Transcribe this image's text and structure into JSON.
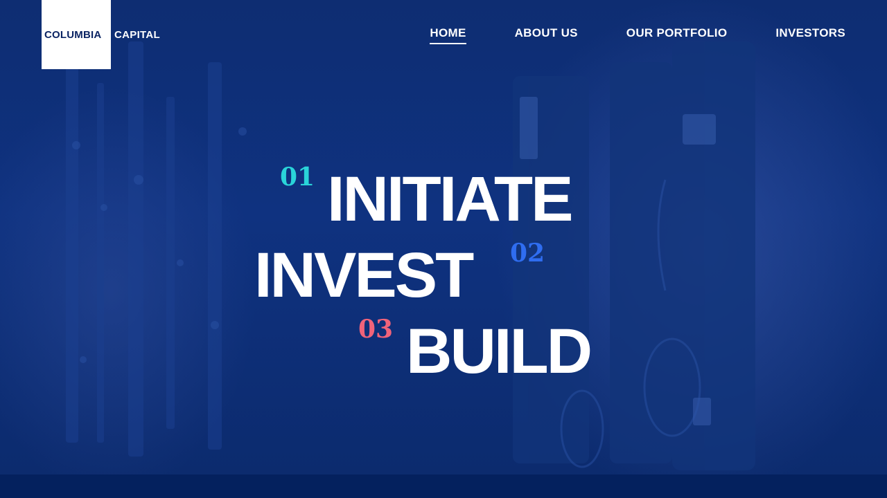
{
  "logo": {
    "primary": "COLUMBIA",
    "secondary": "CAPITAL"
  },
  "nav": {
    "items": [
      {
        "label": "HOME",
        "active": true
      },
      {
        "label": "ABOUT US",
        "active": false
      },
      {
        "label": "OUR PORTFOLIO",
        "active": false
      },
      {
        "label": "INVESTORS",
        "active": false
      }
    ]
  },
  "hero": {
    "steps": [
      {
        "number": "01",
        "word": "INITIATE",
        "color": "#2ad4d9"
      },
      {
        "number": "02",
        "word": "INVEST",
        "color": "#2f6df0"
      },
      {
        "number": "03",
        "word": "BUILD",
        "color": "#f0637a"
      }
    ]
  },
  "colors": {
    "background": "#0c2a6c",
    "footer": "#04215e",
    "text": "#ffffff"
  }
}
